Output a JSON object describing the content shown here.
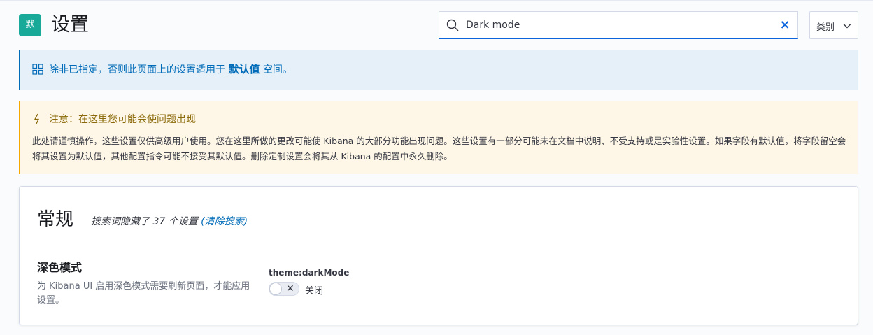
{
  "header": {
    "space_badge": "默",
    "title": "设置"
  },
  "search": {
    "value": "Dark mode",
    "placeholder": ""
  },
  "category_button": {
    "label": "类别"
  },
  "info_callout": {
    "text_before": "除非已指定，否则此页面上的设置适用于",
    "space_name": "默认值",
    "text_after": "空间。"
  },
  "warning_callout": {
    "title": "注意：在这里您可能会使问题出现",
    "body": "此处请谨慎操作，这些设置仅供高级用户使用。您在这里所做的更改可能使 Kibana 的大部分功能出现问题。这些设置有一部分可能未在文档中说明、不受支持或是实验性设置。如果字段有默认值，将字段留空会将其设置为默认值，其他配置指令可能不接受其默认值。删除定制设置会将其从 Kibana 的配置中永久删除。"
  },
  "section": {
    "title": "常规",
    "hidden_text": "搜索词隐藏了 37 个设置",
    "clear_search": "(清除搜索)"
  },
  "setting": {
    "title": "深色模式",
    "description": "为 Kibana UI 启用深色模式需要刷新页面，才能应用设置。",
    "key": "theme:darkMode",
    "toggle_state": "关闭",
    "toggle_on": false
  },
  "colors": {
    "accent": "#0b64dd",
    "space_badge": "#18a999",
    "info": "#006bb8",
    "warning": "#f5a700"
  }
}
